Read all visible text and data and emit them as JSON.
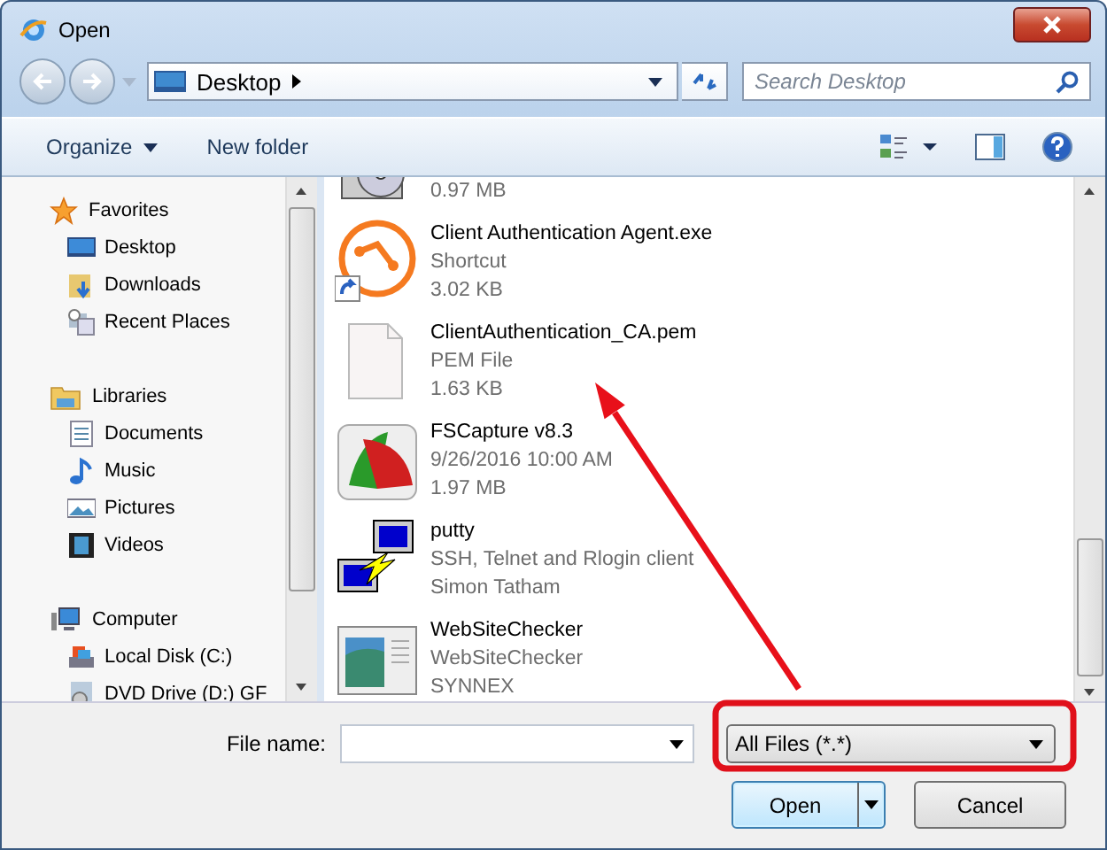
{
  "window": {
    "title": "Open"
  },
  "address": {
    "location": "Desktop"
  },
  "search": {
    "placeholder": "Search Desktop"
  },
  "toolbar": {
    "organize": "Organize",
    "new_folder": "New folder"
  },
  "sidebar": {
    "groups": [
      {
        "label": "Favorites",
        "items": [
          {
            "label": "Desktop"
          },
          {
            "label": "Downloads"
          },
          {
            "label": "Recent Places"
          }
        ]
      },
      {
        "label": "Libraries",
        "items": [
          {
            "label": "Documents"
          },
          {
            "label": "Music"
          },
          {
            "label": "Pictures"
          },
          {
            "label": "Videos"
          }
        ]
      },
      {
        "label": "Computer",
        "items": [
          {
            "label": "Local Disk (C:)"
          },
          {
            "label": "DVD Drive (D:) GF"
          }
        ]
      }
    ]
  },
  "files": [
    {
      "lines": [
        "0.97 MB"
      ]
    },
    {
      "name": "Client Authentication Agent.exe",
      "lines": [
        "Shortcut",
        "3.02 KB"
      ]
    },
    {
      "name": "ClientAuthentication_CA.pem",
      "lines": [
        "PEM File",
        "1.63 KB"
      ]
    },
    {
      "name": "FSCapture v8.3",
      "lines": [
        "9/26/2016 10:00 AM",
        "1.97 MB"
      ]
    },
    {
      "name": "putty",
      "lines": [
        "SSH, Telnet and Rlogin client",
        "Simon Tatham"
      ]
    },
    {
      "name": "WebSiteChecker",
      "lines": [
        "WebSiteChecker",
        "SYNNEX"
      ]
    }
  ],
  "file_name": {
    "label": "File name:"
  },
  "filter": {
    "value": "All Files (*.*)"
  },
  "buttons": {
    "open": "Open",
    "cancel": "Cancel"
  }
}
